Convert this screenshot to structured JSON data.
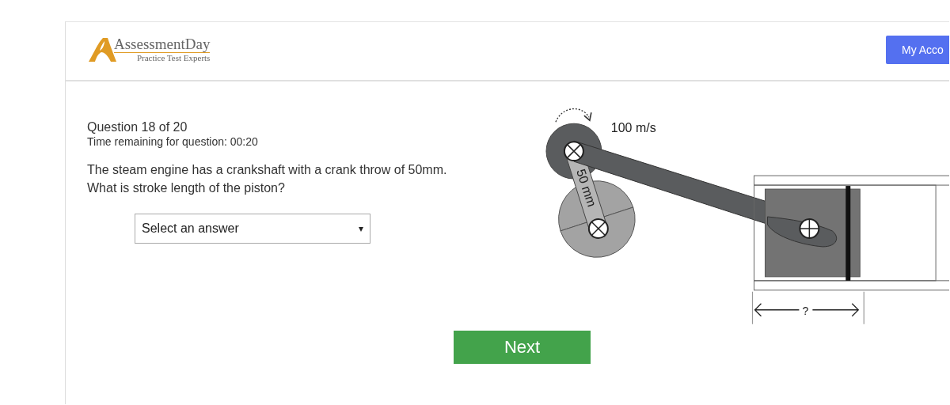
{
  "header": {
    "logo": {
      "name": "AssessmentDay",
      "tagline": "Practice Test Experts"
    },
    "account_button": "My Acco"
  },
  "question": {
    "counter": "Question 18 of 20",
    "timer": "Time remaining for question: 00:20",
    "text": [
      "The steam engine has a crankshaft with a crank throw of 50mm.",
      "What is stroke length of the piston?"
    ],
    "answer_select": {
      "placeholder": "Select an answer",
      "arrow": "▾"
    }
  },
  "diagram": {
    "speed_label": "100 m/s",
    "throw_label": "50 mm",
    "stroke_label": "?"
  },
  "next_button": "Next"
}
